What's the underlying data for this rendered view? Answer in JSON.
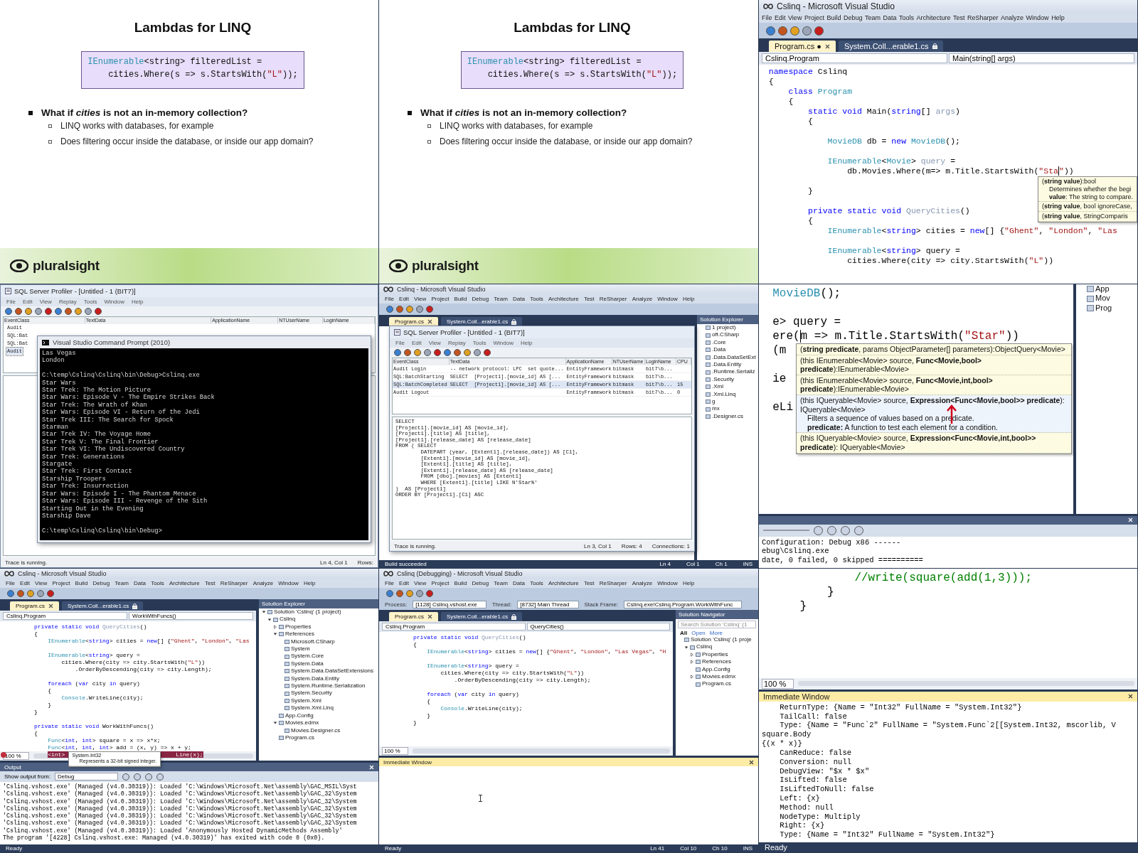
{
  "tiles": [
    {
      "kind": "slide",
      "title": "Lambdas for LINQ",
      "code": [
        {
          "parts": [
            {
              "text": "IEnumerable",
              "kind": "type"
            },
            {
              "text": "<string> filteredList ="
            }
          ]
        },
        {
          "parts": [
            {
              "text": "    cities.Where(s => s.StartsWith("
            },
            {
              "text": "\"L\"",
              "kind": "string"
            },
            {
              "text": "));"
            }
          ]
        }
      ],
      "bullets": [
        {
          "text": "What if *cities* is not an in-memory collection?",
          "children": [
            {
              "text": "LINQ works with databases, for example"
            },
            {
              "text": "Does filtering occur inside the database, or inside our app domain?"
            }
          ]
        }
      ],
      "logo": "pluralsight"
    },
    {
      "kind": "slide",
      "title": "Lambdas for LINQ",
      "code": [
        {
          "parts": [
            {
              "text": "IEnumerable",
              "kind": "type"
            },
            {
              "text": "<string> filteredList ="
            }
          ]
        },
        {
          "parts": [
            {
              "text": "    cities.Where(s => s.StartsWith("
            },
            {
              "text": "\"L\"",
              "kind": "string"
            },
            {
              "text": "));"
            }
          ]
        }
      ],
      "bullets": [
        {
          "text": "What if *cities* is not an in-memory collection?",
          "children": [
            {
              "text": "LINQ works with databases, for example"
            },
            {
              "text": "Does filtering occur inside the database, or inside our app domain?"
            }
          ]
        }
      ],
      "logo": "pluralsight"
    },
    {
      "kind": "ide_zoomed",
      "title": "Cslinq - Microsoft Visual Studio",
      "menu": [
        "File",
        "Edit",
        "View",
        "Project",
        "Build",
        "Debug",
        "Team",
        "Data",
        "Tools",
        "Architecture",
        "Test",
        "ReSharper",
        "Analyze",
        "Window",
        "Help"
      ],
      "tabs": [
        {
          "label": "Program.cs ●",
          "selected": true
        },
        {
          "label": "System.Coll...erable1.cs",
          "selected": false,
          "locked": true
        }
      ],
      "nav": [
        "Cslinq.Program",
        "Main(string[] args)"
      ],
      "code": [
        {
          "parts": [
            {
              "text": "namespace",
              "kind": "keyword"
            },
            {
              "text": " Cslinq"
            }
          ]
        },
        {
          "parts": [
            {
              "text": "{"
            }
          ]
        },
        {
          "parts": [
            {
              "text": "    class",
              "kind": "keyword"
            },
            {
              "text": " Program",
              "kind": "type"
            }
          ]
        },
        {
          "parts": [
            {
              "text": "    {"
            }
          ]
        },
        {
          "parts": [
            {
              "text": "        static void",
              "kind": "keyword"
            },
            {
              "text": " Main("
            },
            {
              "text": "string",
              "kind": "keyword"
            },
            {
              "text": "[] "
            },
            {
              "text": "args",
              "kind": "muted"
            },
            {
              "text": ")"
            }
          ]
        },
        {
          "parts": [
            {
              "text": "        {"
            }
          ]
        },
        {
          "space_before": true,
          "parts": [
            {
              "text": "            MovieDB",
              "kind": "type"
            },
            {
              "text": " db = "
            },
            {
              "text": "new",
              "kind": "keyword"
            },
            {
              "text": " MovieDB",
              "kind": "type"
            },
            {
              "text": "();"
            }
          ]
        },
        {
          "space_before": true,
          "parts": [
            {
              "text": "            IEnumerable",
              "kind": "type"
            },
            {
              "text": "<"
            },
            {
              "text": "Movie",
              "kind": "type"
            },
            {
              "text": "> "
            },
            {
              "text": "query",
              "kind": "muted"
            },
            {
              "text": " ="
            }
          ]
        },
        {
          "parts": [
            {
              "text": "                db.Movies.Where(m=> m.Title.StartsWith("
            },
            {
              "text": "\"Sta",
              "kind": "string",
              "cursor": true
            },
            {
              "text": "\"",
              "kind": "string"
            },
            {
              "text": "))"
            }
          ]
        },
        {
          "space_before": true,
          "parts": [
            {
              "text": "        }"
            }
          ]
        },
        {
          "space_before": true,
          "parts": [
            {
              "text": "        private static void",
              "kind": "keyword"
            },
            {
              "text": " QueryCities",
              "kind": "muted"
            },
            {
              "text": "()"
            }
          ]
        },
        {
          "parts": [
            {
              "text": "        {"
            }
          ]
        },
        {
          "parts": [
            {
              "text": "            IEnumerable",
              "kind": "type"
            },
            {
              "text": "<"
            },
            {
              "text": "string",
              "kind": "keyword"
            },
            {
              "text": "> cities = "
            },
            {
              "text": "new",
              "kind": "keyword"
            },
            {
              "text": "[] {"
            },
            {
              "text": "\"Ghent\"",
              "kind": "string"
            },
            {
              "text": ", "
            },
            {
              "text": "\"London\"",
              "kind": "string"
            },
            {
              "text": ", "
            },
            {
              "text": "\"Las",
              "kind": "string"
            }
          ]
        },
        {
          "space_before": true,
          "parts": [
            {
              "text": "            IEnumerable",
              "kind": "type"
            },
            {
              "text": "<"
            },
            {
              "text": "string",
              "kind": "keyword"
            },
            {
              "text": "> query ="
            }
          ]
        },
        {
          "parts": [
            {
              "text": "                cities.Where(city => city.StartsWith("
            },
            {
              "text": "\"L\"",
              "kind": "string"
            },
            {
              "text": "))"
            }
          ]
        }
      ],
      "tooltip": {
        "kind": "signature",
        "items": [
          {
            "text": "(**string value**):bool",
            "description": [
              "Determines whether the begi",
              "**value**: The string to compare."
            ]
          },
          {
            "text": "(**string value**, bool ignoreCase,"
          },
          {
            "text": "(**string value**, StringComparis"
          }
        ]
      }
    },
    {
      "kind": "profiler",
      "profiler": {
        "title": "SQL Server Profiler - [Untitled - 1 (BIT7)]",
        "menu": [
          "File",
          "Edit",
          "View",
          "Replay",
          "Tools",
          "Window",
          "Help"
        ],
        "columns": [
          "EventClass",
          "TextData",
          "ApplicationName",
          "NTUserName",
          "LoginName"
        ],
        "rows": [
          {
            "cells": [
              "Audit"
            ],
            "selected": false
          },
          {
            "cells": [
              "SQL:Bat"
            ],
            "selected": false
          },
          {
            "cells": [
              "SQL:Bat"
            ],
            "selected": false
          },
          {
            "cells": [
              "Audit"
            ],
            "selected": true
          }
        ],
        "status": [
          "Trace is running.",
          "Ln 4, Col 1",
          "Rows:"
        ]
      },
      "console": {
        "title": "Visual Studio Command Prompt (2010)",
        "lines": [
          {
            "text": "Las Vegas"
          },
          {
            "text": "London"
          },
          {
            "text": "C:\\temp\\Cslinq\\Cslinq\\bin\\Debug>Cslinq.exe",
            "space_before": true
          },
          {
            "text": "Star Wars"
          },
          {
            "text": "Star Trek: The Motion Picture"
          },
          {
            "text": "Star Wars: Episode V - The Empire Strikes Back"
          },
          {
            "text": "Star Trek: The Wrath of Khan"
          },
          {
            "text": "Star Wars: Episode VI - Return of the Jedi"
          },
          {
            "text": "Star Trek III: The Search for Spock"
          },
          {
            "text": "Starman"
          },
          {
            "text": "Star Trek IV: The Voyage Home"
          },
          {
            "text": "Star Trek V: The Final Frontier"
          },
          {
            "text": "Star Trek VI: The Undiscovered Country"
          },
          {
            "text": "Star Trek: Generations"
          },
          {
            "text": "Stargate"
          },
          {
            "text": "Star Trek: First Contact"
          },
          {
            "text": "Starship Troopers"
          },
          {
            "text": "Star Trek: Insurrection"
          },
          {
            "text": "Star Wars: Episode I - The Phantom Menace"
          },
          {
            "text": "Star Wars: Episode III - Revenge of the Sith"
          },
          {
            "text": "Starting Out in the Evening"
          },
          {
            "text": "Starship Dave"
          },
          {
            "text": "C:\\temp\\Cslinq\\Cslinq\\bin\\Debug>",
            "space_before": true
          }
        ]
      }
    },
    {
      "kind": "ide",
      "title": "Cslinq - Microsoft Visual Studio",
      "menu": [
        "File",
        "Edit",
        "View",
        "Project",
        "Build",
        "Debug",
        "Team",
        "Data",
        "Tools",
        "Architecture",
        "Test",
        "ReSharper",
        "Analyze",
        "Window",
        "Help"
      ],
      "tabs": [
        {
          "label": "Program.cs",
          "selected": true
        },
        {
          "label": "System.Coll...erable1.cs",
          "selected": false,
          "locked": true
        }
      ],
      "side_panel": {
        "title": "Solution Explorer",
        "items": [
          {
            "label": "1 project)"
          },
          {
            "label": "oft.CSharp"
          },
          {
            "label": ".Core"
          },
          {
            "label": ".Data"
          },
          {
            "label": ".Data.DataSetExt"
          },
          {
            "label": ".Data.Entity"
          },
          {
            "label": ".Runtime.Serializ"
          },
          {
            "label": ".Security"
          },
          {
            "label": ".Xml"
          },
          {
            "label": ".Xml.Linq"
          },
          {
            "label": "g"
          },
          {
            "label": "mx"
          },
          {
            "label": ".Designer.cs"
          }
        ]
      },
      "overlay": {
        "title": "SQL Server Profiler - [Untitled - 1 (BIT7)]",
        "menu": [
          "File",
          "Edit",
          "View",
          "Replay",
          "Tools",
          "Window",
          "Help"
        ],
        "columns": [
          "EventClass",
          "TextData",
          "ApplicationName",
          "NTUserName",
          "LoginName",
          "CPU"
        ],
        "rows": [
          {
            "cells": [
              "Audit Login",
              "-- network protocol: LPC  set quote...",
              "EntityFramework",
              "bitmask",
              "bit7\\b..."
            ],
            "selected": false
          },
          {
            "cells": [
              "SQL:BatchStarting",
              "SELECT  [Project1].[movie_id] AS [...",
              "EntityFramework",
              "bitmask",
              "bit7\\b..."
            ],
            "selected": false
          },
          {
            "cells": [
              "SQL:BatchCompleted",
              "SELECT  [Project1].[movie_id] AS [...",
              "EntityFramework",
              "bitmask",
              "bit7\\b...",
              "15"
            ],
            "selected": true
          },
          {
            "cells": [
              "Audit Logout",
              null,
              "EntityFramework",
              "bitmask",
              "bit7\\b...",
              "0"
            ],
            "selected": false
          }
        ],
        "sql_lines": [
          "SELECT",
          "[Project1].[movie_id] AS [movie_id],",
          "[Project1].[title] AS [title],",
          "[Project1].[release_date] AS [release_date]",
          "FROM ( SELECT",
          "        DATEPART (year, [Extent1].[release_date]) AS [C1],",
          "        [Extent1].[movie_id] AS [movie_id],",
          "        [Extent1].[title] AS [title],",
          "        [Extent1].[release_date] AS [release_date]",
          "        FROM [dbo].[movies] AS [Extent1]",
          "        WHERE [Extent1].[title] LIKE N'Star%'",
          ")  AS [Project1]",
          "ORDER BY [Project1].[C1] ASC"
        ],
        "status": [
          "Trace is running.",
          "Ln 3, Col 1",
          "Rows: 4",
          "Connections: 1"
        ]
      },
      "status": [
        "Build succeeded",
        "Ln 4",
        "Col 1",
        "Ch 1",
        "INS"
      ]
    },
    {
      "kind": "ide_closeup",
      "code": [
        {
          "parts": [
            {
              "text": "MovieDB",
              "kind": "type"
            },
            {
              "text": "();"
            }
          ]
        },
        {
          "space_before": true,
          "parts": [
            {
              "text": "e> query ="
            }
          ]
        },
        {
          "parts": [
            {
              "text": "ere(",
              "cursor": true
            },
            {
              "text": "m => m.Title.StartsWith("
            },
            {
              "text": "\"Star\"",
              "kind": "string"
            },
            {
              "text": "))"
            }
          ]
        },
        {
          "parts": [
            {
              "text": "(m"
            }
          ]
        },
        {
          "space_before": true,
          "parts": [
            {
              "text": "ie"
            }
          ]
        },
        {
          "space_before": true,
          "parts": [
            {
              "text": "eLi"
            }
          ]
        }
      ],
      "tooltip": {
        "kind": "overloads",
        "items": [
          {
            "text": "(**string predicate**, params ObjectParameter[] parameters):ObjectQuery<Movie>",
            "selected": false
          },
          {
            "text": "(this IEnumerable<Movie> source, **Func<Movie,bool> predicate**):IEnumerable<Movie>",
            "selected": false
          },
          {
            "text": "(this IEnumerable<Movie> source, **Func<Movie,int,bool> predicate**):IEnumerable<Movie>",
            "selected": false
          },
          {
            "text": "(this IQueryable<Movie> source, **Expression<Func<Movie,bool>> predicate**): IQueryable<Movie>",
            "selected": true,
            "marked": true,
            "description": [
              "Filters a sequence of values based on a predicate.",
              "**predicate:** A function to test each element for a condition."
            ]
          },
          {
            "text": "(this IQueryable<Movie> source, **Expression<Func<Movie,int,bool>> predicate**): IQueryable<Movie>",
            "selected": false
          }
        ]
      },
      "side_panel": {
        "items": [
          {
            "label": "App"
          },
          {
            "label": "Mov"
          },
          {
            "label": "Prog"
          }
        ]
      },
      "bottom_panel": {
        "active": false,
        "toolbar": true,
        "lines": [
          "Configuration: Debug x86 ------",
          "ebug\\Cslinq.exe",
          "date, 0 failed, 0 skipped =========="
        ]
      }
    },
    {
      "kind": "ide",
      "title": "Cslinq - Microsoft Visual Studio",
      "menu": [
        "File",
        "Edit",
        "View",
        "Project",
        "Build",
        "Debug",
        "Team",
        "Data",
        "Tools",
        "Architecture",
        "Test",
        "ReSharper",
        "Analyze",
        "Window",
        "Help"
      ],
      "tabs": [
        {
          "label": "Program.cs",
          "selected": true
        },
        {
          "label": "System.Coll...erable1.cs",
          "selected": false,
          "locked": true
        }
      ],
      "nav": [
        "Cslinq.Program",
        "WorkWithFuncs()"
      ],
      "code": [
        {
          "parts": [
            {
              "text": "        private static void",
              "kind": "keyword"
            },
            {
              "text": " QueryCities",
              "kind": "muted"
            },
            {
              "text": "()"
            }
          ]
        },
        {
          "parts": [
            {
              "text": "        {"
            }
          ]
        },
        {
          "parts": [
            {
              "text": "            IEnumerable",
              "kind": "type"
            },
            {
              "text": "<"
            },
            {
              "text": "string",
              "kind": "keyword"
            },
            {
              "text": "> cities = "
            },
            {
              "text": "new",
              "kind": "keyword"
            },
            {
              "text": "[] {"
            },
            {
              "text": "\"Ghent\"",
              "kind": "string"
            },
            {
              "text": ", "
            },
            {
              "text": "\"London\"",
              "kind": "string"
            },
            {
              "text": ", "
            },
            {
              "text": "\"Las",
              "kind": "string"
            }
          ]
        },
        {
          "space_before": true,
          "parts": [
            {
              "text": "            IEnumerable",
              "kind": "type"
            },
            {
              "text": "<"
            },
            {
              "text": "string",
              "kind": "keyword"
            },
            {
              "text": "> query ="
            }
          ]
        },
        {
          "parts": [
            {
              "text": "                cities.Where(city => city.StartsWith("
            },
            {
              "text": "\"L\"",
              "kind": "string"
            },
            {
              "text": "))"
            }
          ]
        },
        {
          "parts": [
            {
              "text": "                    .OrderByDescending(city => city.Length);"
            }
          ]
        },
        {
          "space_before": true,
          "parts": [
            {
              "text": "            foreach",
              "kind": "keyword"
            },
            {
              "text": " ("
            },
            {
              "text": "var",
              "kind": "keyword"
            },
            {
              "text": " city "
            },
            {
              "text": "in",
              "kind": "keyword"
            },
            {
              "text": " query)"
            }
          ]
        },
        {
          "parts": [
            {
              "text": "            {"
            }
          ]
        },
        {
          "parts": [
            {
              "text": "                Console",
              "kind": "type"
            },
            {
              "text": ".WriteLine(city);"
            }
          ]
        },
        {
          "parts": [
            {
              "text": "            }"
            }
          ]
        },
        {
          "parts": [
            {
              "text": "        }"
            }
          ]
        },
        {
          "space_before": true,
          "parts": [
            {
              "text": "        private static void",
              "kind": "keyword"
            },
            {
              "text": " WorkWithFuncs()"
            }
          ]
        },
        {
          "parts": [
            {
              "text": "        {"
            }
          ]
        },
        {
          "parts": [
            {
              "text": "            Func",
              "kind": "type"
            },
            {
              "text": "<"
            },
            {
              "text": "int",
              "kind": "keyword"
            },
            {
              "text": ", "
            },
            {
              "text": "int",
              "kind": "keyword"
            },
            {
              "text": "> square = x => x*x;"
            }
          ]
        },
        {
          "parts": [
            {
              "text": "            Func",
              "kind": "type"
            },
            {
              "text": "<"
            },
            {
              "text": "int",
              "kind": "keyword"
            },
            {
              "text": ", "
            },
            {
              "text": "int",
              "kind": "keyword"
            },
            {
              "text": ", "
            },
            {
              "text": "int",
              "kind": "keyword"
            },
            {
              "text": "> add = (x, y) => x + y;"
            }
          ]
        },
        {
          "breakpoint": true,
          "parts": [
            {
              "text": "            <int>",
              "kind": "highlight"
            },
            {
              "text": "Line(x);",
              "kind": "highlight"
            }
          ],
          "tooltip": {
            "kind": "quickinfo",
            "items": [
              {
                "text": "System.Int32",
                "description": [
                  "Represents a 32-bit signed integer."
                ]
              }
            ]
          }
        }
      ],
      "zoom": "100 %",
      "side_panel": {
        "title": "Solution Explorer",
        "items": [
          {
            "label": "Solution 'Cslinq' (1 project)",
            "expanded": true,
            "children": [
              {
                "label": "Cslinq",
                "expanded": true,
                "children": [
                  {
                    "label": "Properties",
                    "expanded": false
                  },
                  {
                    "label": "References",
                    "expanded": true,
                    "children": [
                      {
                        "label": "Microsoft.CSharp"
                      },
                      {
                        "label": "System"
                      },
                      {
                        "label": "System.Core"
                      },
                      {
                        "label": "System.Data"
                      },
                      {
                        "label": "System.Data.DataSetExtensions"
                      },
                      {
                        "label": "System.Data.Entity"
                      },
                      {
                        "label": "System.Runtime.Serialization"
                      },
                      {
                        "label": "System.Security"
                      },
                      {
                        "label": "System.Xml"
                      },
                      {
                        "label": "System.Xml.Linq"
                      }
                    ]
                  },
                  {
                    "label": "App.Config"
                  },
                  {
                    "label": "Movies.edmx",
                    "expanded": true,
                    "children": [
                      {
                        "label": "Movies.Designer.cs"
                      }
                    ]
                  },
                  {
                    "label": "Program.cs"
                  }
                ]
              }
            ]
          }
        ]
      },
      "bottom_panel": {
        "title": "Output",
        "active": false,
        "toolbar": true,
        "source_label": "Show output from:",
        "source": "Debug",
        "lines": [
          "'Cslinq.vshost.exe' (Managed (v4.0.30319)): Loaded 'C:\\Windows\\Microsoft.Net\\assembly\\GAC_MSIL\\Syst",
          "'Cslinq.vshost.exe' (Managed (v4.0.30319)): Loaded 'C:\\Windows\\Microsoft.Net\\assembly\\GAC_32\\System",
          "'Cslinq.vshost.exe' (Managed (v4.0.30319)): Loaded 'C:\\Windows\\Microsoft.Net\\assembly\\GAC_32\\System",
          "'Cslinq.vshost.exe' (Managed (v4.0.30319)): Loaded 'C:\\Windows\\Microsoft.Net\\assembly\\GAC_32\\System",
          "'Cslinq.vshost.exe' (Managed (v4.0.30319)): Loaded 'C:\\Windows\\Microsoft.Net\\assembly\\GAC_32\\System",
          "'Cslinq.vshost.exe' (Managed (v4.0.30319)): Loaded 'C:\\Windows\\Microsoft.Net\\assembly\\GAC_32\\System",
          "'Cslinq.vshost.exe' (Managed (v4.0.30319)): Loaded 'Anonymously Hosted DynamicMethods Assembly'",
          "The program '[4228] Cslinq.vshost.exe: Managed (v4.0.30319)' has exited with code 0 (0x0)."
        ]
      },
      "status": [
        "Ready"
      ]
    },
    {
      "kind": "ide",
      "title": "Cslinq (Debugging) - Microsoft Visual Studio",
      "menu": [
        "File",
        "Edit",
        "View",
        "Project",
        "Build",
        "Debug",
        "Team",
        "Data",
        "Tools",
        "Architecture",
        "Test",
        "ReSharper",
        "Analyze",
        "Window",
        "Help"
      ],
      "debug_bar": [
        {
          "label": "Process:",
          "value": "[1128] Cslinq.vshost.exe"
        },
        {
          "label": "Thread:",
          "value": "[8732] Main Thread"
        },
        {
          "label": "Stack Frame:",
          "value": "Cslinq.exe!Cslinq.Program.WorkWithFunc"
        }
      ],
      "tabs": [
        {
          "label": "Program.cs",
          "selected": true
        },
        {
          "label": "System.Coll...erable1.cs",
          "selected": false,
          "locked": true
        }
      ],
      "nav": [
        "Cslinq.Program",
        "QueryCities()"
      ],
      "code": [
        {
          "parts": [
            {
              "text": "        private static void",
              "kind": "keyword"
            },
            {
              "text": " QueryCities",
              "kind": "muted"
            },
            {
              "text": "()"
            }
          ]
        },
        {
          "parts": [
            {
              "text": "        {"
            }
          ]
        },
        {
          "parts": [
            {
              "text": "            IEnumerable",
              "kind": "type"
            },
            {
              "text": "<"
            },
            {
              "text": "string",
              "kind": "keyword"
            },
            {
              "text": "> cities = "
            },
            {
              "text": "new",
              "kind": "keyword"
            },
            {
              "text": "[] {"
            },
            {
              "text": "\"Ghent\"",
              "kind": "string"
            },
            {
              "text": ", "
            },
            {
              "text": "\"London\"",
              "kind": "string"
            },
            {
              "text": ", "
            },
            {
              "text": "\"Las Vegas\"",
              "kind": "string"
            },
            {
              "text": ", "
            },
            {
              "text": "\"H",
              "kind": "string"
            }
          ]
        },
        {
          "space_before": true,
          "parts": [
            {
              "text": "            IEnumerable",
              "kind": "type"
            },
            {
              "text": "<"
            },
            {
              "text": "string",
              "kind": "keyword"
            },
            {
              "text": "> query ="
            }
          ]
        },
        {
          "parts": [
            {
              "text": "                cities.Where(city => city.StartsWith("
            },
            {
              "text": "\"L\"",
              "kind": "string"
            },
            {
              "text": "))"
            }
          ]
        },
        {
          "parts": [
            {
              "text": "                    .OrderByDescending(city => city.Length);"
            }
          ]
        },
        {
          "space_before": true,
          "parts": [
            {
              "text": "            foreach",
              "kind": "keyword"
            },
            {
              "text": " ("
            },
            {
              "text": "var",
              "kind": "keyword"
            },
            {
              "text": " city "
            },
            {
              "text": "in",
              "kind": "keyword"
            },
            {
              "text": " query)"
            }
          ]
        },
        {
          "parts": [
            {
              "text": "            {"
            }
          ]
        },
        {
          "parts": [
            {
              "text": "                Console",
              "kind": "type"
            },
            {
              "text": ".WriteLine(city);"
            }
          ]
        },
        {
          "parts": [
            {
              "text": "            }"
            }
          ]
        },
        {
          "parts": [
            {
              "text": "        }"
            }
          ]
        }
      ],
      "zoom": "100 %",
      "side_panel": {
        "title": "Solution Navigator",
        "search": "Search Solution 'Cslinq' (1",
        "filters": [
          {
            "label": "All",
            "selected": true
          },
          {
            "label": "Open",
            "selected": false
          },
          {
            "label": "More",
            "selected": false
          }
        ],
        "items": [
          {
            "label": "Solution 'Cslinq' (1 proje",
            "children": [
              {
                "label": "Cslinq",
                "expanded": true,
                "children": [
                  {
                    "label": "Properties",
                    "expanded": false
                  },
                  {
                    "label": "References",
                    "expanded": false
                  },
                  {
                    "label": "App.Config"
                  },
                  {
                    "label": "Movies.edmx",
                    "expanded": false
                  },
                  {
                    "label": "Program.cs"
                  }
                ]
              }
            ]
          }
        ]
      },
      "bottom_panel": {
        "title": "Immediate Window",
        "active": true,
        "cursor": true
      },
      "status": [
        "Ready",
        "Ln 41",
        "Col 10",
        "Ch 10",
        "INS"
      ]
    },
    {
      "kind": "ide_closeup",
      "code": [
        {
          "parts": [
            {
              "text": "            //write(square(add(1,3)));",
              "kind": "comment"
            }
          ]
        },
        {
          "parts": [
            {
              "text": "        }"
            }
          ]
        },
        {
          "parts": [
            {
              "text": "    }"
            }
          ]
        }
      ],
      "zoom": "100 %",
      "bottom_panel": {
        "title": "Immediate Window",
        "active": true,
        "lines": [
          "    ReturnType: {Name = \"Int32\" FullName = \"System.Int32\"}",
          "    TailCall: false",
          "    Type: {Name = \"Func`2\" FullName = \"System.Func`2[[System.Int32, mscorlib, V",
          "square.Body",
          "{(x * x)}",
          "    CanReduce: false",
          "    Conversion: null",
          "    DebugView: \"$x * $x\"",
          "    IsLifted: false",
          "    IsLiftedToNull: false",
          "    Left: {x}",
          "    Method: null",
          "    NodeType: Multiply",
          "    Right: {x}",
          "    Type: {Name = \"Int32\" FullName = \"System.Int32\"}"
        ]
      },
      "status": [
        "Ready"
      ]
    }
  ]
}
